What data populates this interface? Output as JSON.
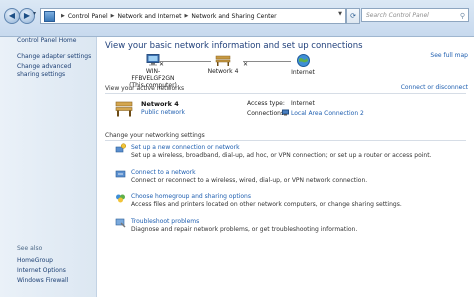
{
  "address_bar": {
    "back_label": "◀",
    "forward_label": "▶",
    "recent_label": "▾",
    "crumbs": [
      "Control Panel",
      "Network and Internet",
      "Network and Sharing Center"
    ],
    "refresh_label": "⟳",
    "search_placeholder": "Search Control Panel"
  },
  "sidebar": {
    "items": [
      {
        "label": "Control Panel Home"
      },
      {
        "label": "Change adapter settings"
      },
      {
        "label": "Change advanced sharing settings"
      }
    ],
    "see_also_header": "See also",
    "see_also": [
      {
        "label": "HomeGroup"
      },
      {
        "label": "Internet Options"
      },
      {
        "label": "Windows Firewall"
      }
    ]
  },
  "main": {
    "title": "View your basic network information and set up connections",
    "see_full_map": "See full map",
    "map": {
      "computer_name": "WIN-FFBVELGF2GN",
      "computer_sub": "(This computer)",
      "network_name": "Network 4",
      "internet_name": "Internet"
    },
    "active_header": "View your active networks",
    "connect_disconnect": "Connect or disconnect",
    "active_network": {
      "name": "Network 4",
      "type": "Public network",
      "access_type_label": "Access type:",
      "access_type_value": "Internet",
      "connections_label": "Connections:",
      "connections_value": "Local Area Connection 2"
    },
    "settings_header": "Change your networking settings",
    "settings": [
      {
        "title": "Set up a new connection or network",
        "desc": "Set up a wireless, broadband, dial-up, ad hoc, or VPN connection; or set up a router or access point."
      },
      {
        "title": "Connect to a network",
        "desc": "Connect or reconnect to a wireless, wired, dial-up, or VPN network connection."
      },
      {
        "title": "Choose homegroup and sharing options",
        "desc": "Access files and printers located on other network computers, or change sharing settings."
      },
      {
        "title": "Troubleshoot problems",
        "desc": "Diagnose and repair network problems, or get troubleshooting information."
      }
    ]
  },
  "colors": {
    "link": "#1f5fb0",
    "title": "#1f3f7a",
    "sidebar_bg": "#dce7f2"
  }
}
